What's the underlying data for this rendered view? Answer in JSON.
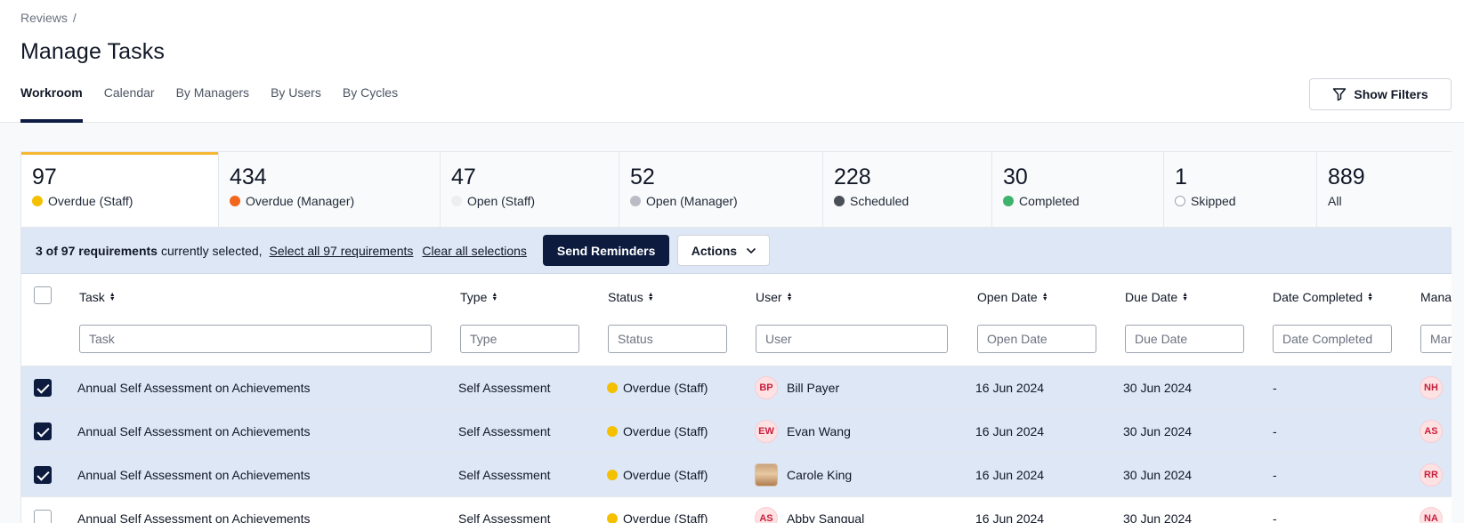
{
  "breadcrumb": {
    "root": "Reviews",
    "sep": "/"
  },
  "page_title": "Manage Tasks",
  "tabs": [
    {
      "label": "Workroom",
      "active": true
    },
    {
      "label": "Calendar",
      "active": false
    },
    {
      "label": "By Managers",
      "active": false
    },
    {
      "label": "By Users",
      "active": false
    },
    {
      "label": "By Cycles",
      "active": false
    }
  ],
  "show_filters_label": "Show Filters",
  "stats": [
    {
      "count": "97",
      "label": "Overdue (Staff)",
      "color": "#f5c000",
      "active": true
    },
    {
      "count": "434",
      "label": "Overdue (Manager)",
      "color": "#f2661d",
      "active": false
    },
    {
      "count": "47",
      "label": "Open (Staff)",
      "color": "#eeeeee",
      "active": false
    },
    {
      "count": "52",
      "label": "Open (Manager)",
      "color": "#b9bcc4",
      "active": false
    },
    {
      "count": "228",
      "label": "Scheduled",
      "color": "#4b4f57",
      "active": false
    },
    {
      "count": "30",
      "label": "Completed",
      "color": "#3fb36b",
      "active": false
    },
    {
      "count": "1",
      "label": "Skipped",
      "color": "#ffffff",
      "active": false
    },
    {
      "count": "889",
      "label": "All",
      "color": "",
      "active": false
    }
  ],
  "selection": {
    "count_text": "3 of 97 requirements",
    "suffix": " currently selected,",
    "select_all": "Select all 97 requirements",
    "clear_all": "Clear all selections",
    "send_reminders": "Send Reminders",
    "actions": "Actions"
  },
  "columns": {
    "task": {
      "label": "Task",
      "placeholder": "Task"
    },
    "type": {
      "label": "Type",
      "placeholder": "Type"
    },
    "status": {
      "label": "Status",
      "placeholder": "Status"
    },
    "user": {
      "label": "User",
      "placeholder": "User"
    },
    "open_date": {
      "label": "Open Date",
      "placeholder": "Open Date"
    },
    "due_date": {
      "label": "Due Date",
      "placeholder": "Due Date"
    },
    "date_completed": {
      "label": "Date Completed",
      "placeholder": "Date Completed"
    },
    "manager": {
      "label": "Mana",
      "placeholder": "Man"
    }
  },
  "rows": [
    {
      "checked": true,
      "task": "Annual Self Assessment on Achievements",
      "type": "Self Assessment",
      "status": "Overdue (Staff)",
      "status_color": "#f5c000",
      "user_initials": "BP",
      "user": "Bill Payer",
      "open_date": "16 Jun 2024",
      "due_date": "30 Jun 2024",
      "date_completed": "-",
      "manager_initials": "NH"
    },
    {
      "checked": true,
      "task": "Annual Self Assessment on Achievements",
      "type": "Self Assessment",
      "status": "Overdue (Staff)",
      "status_color": "#f5c000",
      "user_initials": "EW",
      "user": "Evan Wang",
      "open_date": "16 Jun 2024",
      "due_date": "30 Jun 2024",
      "date_completed": "-",
      "manager_initials": "AS"
    },
    {
      "checked": true,
      "task": "Annual Self Assessment on Achievements",
      "type": "Self Assessment",
      "status": "Overdue (Staff)",
      "status_color": "#f5c000",
      "user_initials": "",
      "user": "Carole King",
      "open_date": "16 Jun 2024",
      "due_date": "30 Jun 2024",
      "date_completed": "-",
      "manager_initials": "RR"
    },
    {
      "checked": false,
      "task": "Annual Self Assessment on Achievements",
      "type": "Self Assessment",
      "status": "Overdue (Staff)",
      "status_color": "#f5c000",
      "user_initials": "AS",
      "user": "Abby Sangual",
      "open_date": "16 Jun 2024",
      "due_date": "30 Jun 2024",
      "date_completed": "-",
      "manager_initials": "NA"
    }
  ]
}
